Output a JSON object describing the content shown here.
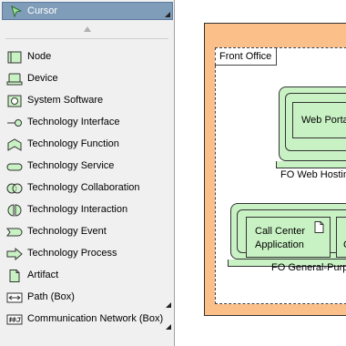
{
  "palette": {
    "cursor_label": "Cursor",
    "items": [
      {
        "label": "Node",
        "icon": "node-icon"
      },
      {
        "label": "Device",
        "icon": "device-icon"
      },
      {
        "label": "System Software",
        "icon": "system-software-icon"
      },
      {
        "label": "Technology Interface",
        "icon": "technology-interface-icon"
      },
      {
        "label": "Technology Function",
        "icon": "technology-function-icon"
      },
      {
        "label": "Technology Service",
        "icon": "technology-service-icon"
      },
      {
        "label": "Technology Collaboration",
        "icon": "technology-collaboration-icon"
      },
      {
        "label": "Technology Interaction",
        "icon": "technology-interaction-icon"
      },
      {
        "label": "Technology Event",
        "icon": "technology-event-icon"
      },
      {
        "label": "Technology Process",
        "icon": "technology-process-icon"
      },
      {
        "label": "Artifact",
        "icon": "artifact-icon"
      },
      {
        "label": "Path (Box)",
        "icon": "path-box-icon"
      },
      {
        "label": "Communication Network (Box)",
        "icon": "communication-network-icon"
      }
    ]
  },
  "diagram": {
    "group_label": "Front Office",
    "web_node_caption": "FO Web Hostin",
    "web_portal_label": "Web Porta",
    "general_node_caption": "FO General-Purp",
    "call_center_label_line1": "Call Center",
    "call_center_label_line2": "Application",
    "partial_label": "C"
  },
  "colors": {
    "group_fill": "#fbbf8a",
    "node_fill": "#c9f2c4",
    "selection": "#7f9db9"
  }
}
